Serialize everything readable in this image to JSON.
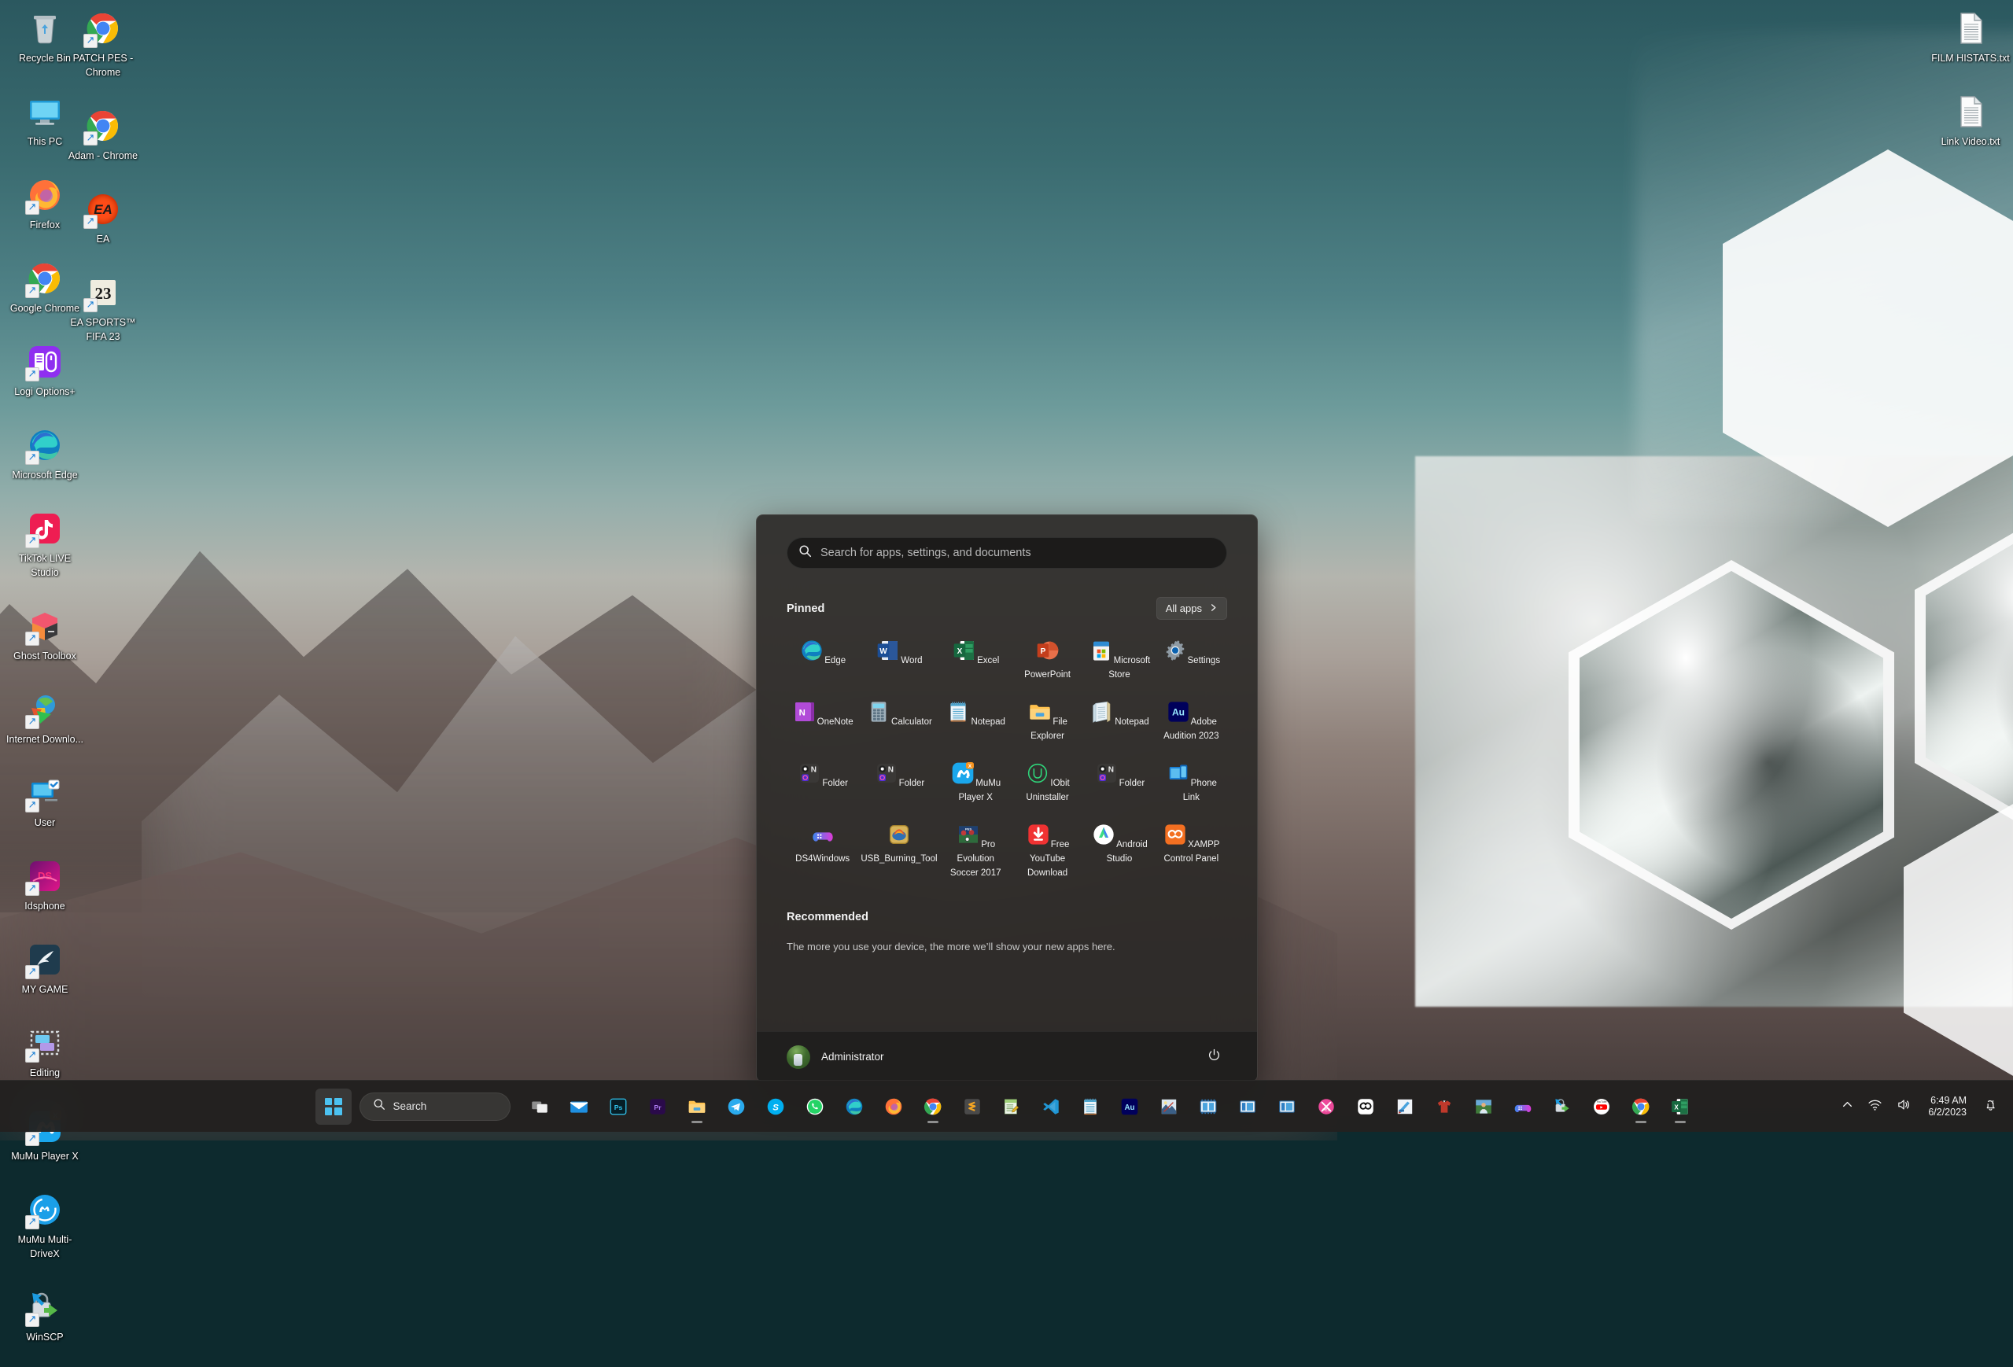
{
  "desktop": {
    "icons_column_1": [
      {
        "label": "Recycle Bin",
        "icon": "recycle-bin-icon",
        "shortcut": false
      },
      {
        "label": "This PC",
        "icon": "this-pc-icon",
        "shortcut": false
      },
      {
        "label": "Firefox",
        "icon": "firefox-icon",
        "shortcut": true
      },
      {
        "label": "Google Chrome",
        "icon": "chrome-icon",
        "shortcut": true
      },
      {
        "label": "Logi Options+",
        "icon": "logi-options-icon",
        "shortcut": true
      },
      {
        "label": "Microsoft Edge",
        "icon": "edge-icon",
        "shortcut": true
      },
      {
        "label": "TikTok LIVE Studio",
        "icon": "tiktok-live-studio-icon",
        "shortcut": true
      },
      {
        "label": "Ghost Toolbox",
        "icon": "ghost-toolbox-icon",
        "shortcut": true
      },
      {
        "label": "Internet Downlo...",
        "icon": "internet-download-manager-icon",
        "shortcut": true
      },
      {
        "label": "User",
        "icon": "user-folder-icon",
        "shortcut": true
      },
      {
        "label": "Idsphone",
        "icon": "idsphone-icon",
        "shortcut": true
      },
      {
        "label": "MY GAME",
        "icon": "my-game-icon",
        "shortcut": true
      },
      {
        "label": "Editing",
        "icon": "editing-folder-icon",
        "shortcut": true
      },
      {
        "label": "MuMu Player X",
        "icon": "mumu-player-x-icon",
        "shortcut": true
      },
      {
        "label": "MuMu Multi-DriveX",
        "icon": "mumu-multi-drivex-icon",
        "shortcut": true
      },
      {
        "label": "WinSCP",
        "icon": "winscp-icon",
        "shortcut": true
      }
    ],
    "icons_column_2": [
      {
        "label": "PATCH PES - Chrome",
        "icon": "chrome-shortcut-icon",
        "shortcut": true
      },
      {
        "label": "Adam - Chrome",
        "icon": "chrome-shortcut-icon",
        "shortcut": true
      },
      {
        "label": "EA",
        "icon": "ea-app-icon",
        "shortcut": true
      },
      {
        "label": "EA SPORTS™ FIFA 23",
        "icon": "fifa-23-icon",
        "shortcut": true
      }
    ],
    "icons_right": [
      {
        "label": "FILM HISTATS.txt",
        "icon": "text-file-icon",
        "shortcut": false
      },
      {
        "label": "Link Video.txt",
        "icon": "text-file-icon",
        "shortcut": false
      }
    ]
  },
  "start_menu": {
    "search": {
      "placeholder": "Search for apps, settings, and documents",
      "value": "",
      "icon": "search-icon"
    },
    "pinned": {
      "title": "Pinned",
      "all_apps_label": "All apps",
      "all_apps_icon": "chevron-right-icon",
      "apps": [
        {
          "label": "Edge",
          "icon": "edge-icon"
        },
        {
          "label": "Word",
          "icon": "word-icon"
        },
        {
          "label": "Excel",
          "icon": "excel-icon"
        },
        {
          "label": "PowerPoint",
          "icon": "powerpoint-icon"
        },
        {
          "label": "Microsoft Store",
          "icon": "microsoft-store-icon"
        },
        {
          "label": "Settings",
          "icon": "settings-gear-icon"
        },
        {
          "label": "OneNote",
          "icon": "onenote-icon"
        },
        {
          "label": "Calculator",
          "icon": "calculator-icon"
        },
        {
          "label": "Notepad",
          "icon": "notepad-icon"
        },
        {
          "label": "File Explorer",
          "icon": "folder-icon"
        },
        {
          "label": "Notepad",
          "icon": "notepad-classic-icon"
        },
        {
          "label": "Adobe Audition 2023",
          "icon": "adobe-audition-icon"
        },
        {
          "label": "Folder",
          "icon": "folder-group-icon"
        },
        {
          "label": "Folder",
          "icon": "folder-group-icon"
        },
        {
          "label": "MuMu Player X",
          "icon": "mumu-player-x-icon"
        },
        {
          "label": "IObit Uninstaller",
          "icon": "iobit-uninstaller-icon"
        },
        {
          "label": "Folder",
          "icon": "folder-group-icon"
        },
        {
          "label": "Phone Link",
          "icon": "phone-link-icon"
        },
        {
          "label": "DS4Windows",
          "icon": "ds4windows-icon"
        },
        {
          "label": "USB_Burning_Tool",
          "icon": "usb-burning-tool-icon"
        },
        {
          "label": "Pro Evolution Soccer 2017",
          "icon": "pes-2017-icon"
        },
        {
          "label": "Free YouTube Download",
          "icon": "free-youtube-download-icon"
        },
        {
          "label": "Android Studio",
          "icon": "android-studio-icon"
        },
        {
          "label": "XAMPP Control Panel",
          "icon": "xampp-icon"
        }
      ]
    },
    "recommended": {
      "title": "Recommended",
      "empty_text": "The more you use your device, the more we’ll show your new apps here."
    },
    "footer": {
      "account_name": "Administrator",
      "account_icon": "avatar",
      "power_icon": "power-icon"
    }
  },
  "taskbar": {
    "start_button": {
      "label": "Start",
      "icon": "windows-logo-icon"
    },
    "search": {
      "label": "Search",
      "icon": "search-icon"
    },
    "items": [
      {
        "name": "task-view",
        "icon": "task-view-icon",
        "active": false
      },
      {
        "name": "mail",
        "icon": "mail-icon",
        "active": false
      },
      {
        "name": "photoshop",
        "icon": "photoshop-icon",
        "active": false
      },
      {
        "name": "premiere-pro",
        "icon": "premiere-pro-icon",
        "active": false
      },
      {
        "name": "file-explorer",
        "icon": "folder-icon",
        "active": true
      },
      {
        "name": "telegram",
        "icon": "telegram-icon",
        "active": false
      },
      {
        "name": "skype",
        "icon": "skype-icon",
        "active": false
      },
      {
        "name": "whatsapp",
        "icon": "whatsapp-icon",
        "active": false
      },
      {
        "name": "microsoft-edge",
        "icon": "edge-icon",
        "active": false
      },
      {
        "name": "firefox",
        "icon": "firefox-icon",
        "active": false
      },
      {
        "name": "google-chrome",
        "icon": "chrome-icon",
        "active": true
      },
      {
        "name": "sublime-text",
        "icon": "sublime-text-icon",
        "active": false
      },
      {
        "name": "notepad-plus-plus",
        "icon": "notepad-plus-plus-icon",
        "active": false
      },
      {
        "name": "visual-studio-code",
        "icon": "vscode-icon",
        "active": false
      },
      {
        "name": "notepad",
        "icon": "notepad-icon",
        "active": false
      },
      {
        "name": "adobe-audition",
        "icon": "adobe-audition-alt-icon",
        "active": false
      },
      {
        "name": "adobe-photoshop-file",
        "icon": "photoshop-file-icon",
        "active": false
      },
      {
        "name": "video-editor",
        "icon": "film-strip-icon",
        "active": false
      },
      {
        "name": "media-player-1",
        "icon": "media-panel-icon",
        "active": false
      },
      {
        "name": "media-player-2",
        "icon": "media-panel-icon",
        "active": false
      },
      {
        "name": "pes-tool",
        "icon": "pes-pink-icon",
        "active": false
      },
      {
        "name": "capcut",
        "icon": "capcut-icon",
        "active": false
      },
      {
        "name": "kit-editor",
        "icon": "kit-editor-icon",
        "active": false
      },
      {
        "name": "jersey-tool",
        "icon": "jersey-icon",
        "active": false
      },
      {
        "name": "player-editor",
        "icon": "player-editor-icon",
        "active": false
      },
      {
        "name": "ds4windows",
        "icon": "ds4windows-icon",
        "active": false
      },
      {
        "name": "winscp",
        "icon": "winscp-icon",
        "active": false
      },
      {
        "name": "youtube-tool",
        "icon": "youtube-sticker-icon",
        "active": false
      },
      {
        "name": "chrome-window",
        "icon": "chrome-window-icon",
        "active": true
      },
      {
        "name": "excel",
        "icon": "excel-icon",
        "active": true
      }
    ],
    "tray": {
      "overflow_icon": "chevron-up-icon",
      "wifi_icon": "wifi-icon",
      "volume_icon": "volume-icon",
      "time": "6:49 AM",
      "date": "6/2/2023",
      "notification_icon": "notification-bell-dnd-icon"
    }
  },
  "colors": {
    "start_bg": "#2b2927",
    "taskbar_bg": "#201f1e",
    "accent": "#4cc2f1",
    "wallpaper_sky": "#3a6b70"
  }
}
